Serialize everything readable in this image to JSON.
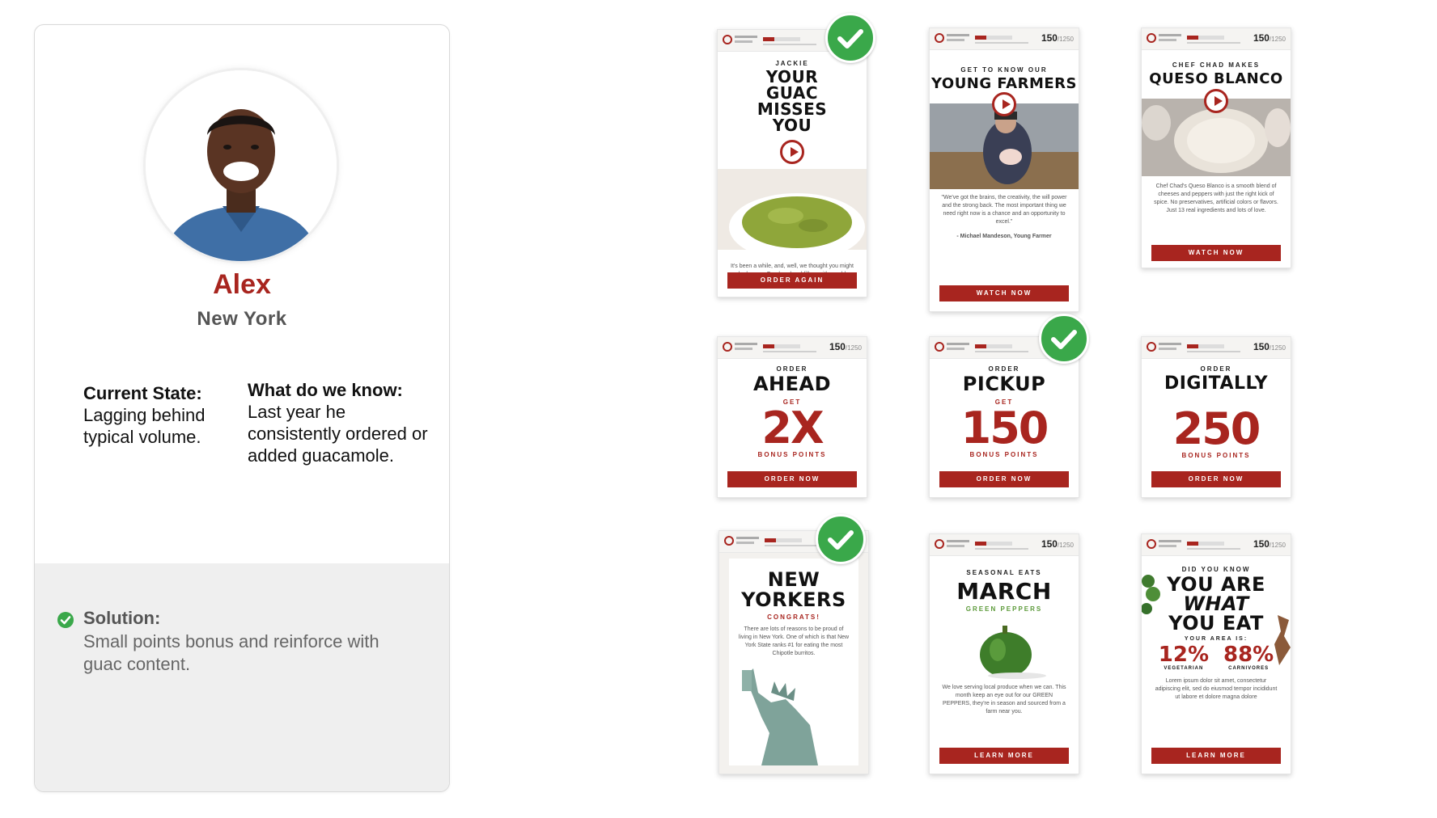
{
  "persona": {
    "name": "Alex",
    "city": "New York",
    "current_state_label": "Current State:",
    "current_state_text": "Lagging behind typical volume.",
    "know_label": "What do we know:",
    "know_text": "Last year he consistently ordered or added guacamole.",
    "solution_label": "Solution:",
    "solution_text": "Small points bonus and reinforce with guac content."
  },
  "tiles": {
    "guac": {
      "kicker": "JACKIE",
      "headline": "YOUR GUAC MISSES YOU",
      "body": "It's been a while, and, well, we thought you might be hungry. Go ahead and fill up with an old favorite.",
      "button": "ORDER AGAIN"
    },
    "farmers": {
      "points": "150",
      "points_total": "/1250",
      "kicker": "GET TO KNOW OUR",
      "headline": "YOUNG FARMERS",
      "body": "\"We've got the brains, the creativity, the will power and the strong back. The most important thing we need right now is a chance and an opportunity to excel.\"",
      "attribution": "- Michael Mandeson, Young Farmer",
      "button": "WATCH NOW"
    },
    "queso": {
      "points": "150",
      "points_total": "/1250",
      "kicker": "CHEF CHAD MAKES",
      "headline": "QUESO BLANCO",
      "body": "Chef Chad's Queso Blanco is a smooth blend of cheeses and peppers with just the right kick of spice. No preservatives, artificial colors or flavors. Just 13 real ingredients and lots of love.",
      "button": "WATCH NOW"
    },
    "ahead": {
      "points": "150",
      "points_total": "/1250",
      "kicker": "ORDER",
      "headline": "AHEAD",
      "get": "GET",
      "value": "2X",
      "sub": "BONUS POINTS",
      "button": "ORDER NOW"
    },
    "pickup": {
      "kicker": "ORDER",
      "headline": "PICKUP",
      "get": "GET",
      "value": "150",
      "sub": "BONUS POINTS",
      "button": "ORDER NOW"
    },
    "digitally": {
      "points": "150",
      "points_total": "/1250",
      "kicker": "ORDER",
      "headline": "DIGITALLY",
      "value": "250",
      "sub": "BONUS POINTS",
      "button": "ORDER NOW"
    },
    "newyorkers": {
      "headline": "NEW YORKERS",
      "sub": "CONGRATS!",
      "body": "There are lots of reasons to be proud of living in New York. One of which is that New York State ranks #1 for eating the most Chipotle burritos."
    },
    "march": {
      "points": "150",
      "points_total": "/1250",
      "kicker": "SEASONAL EATS",
      "headline": "MARCH",
      "sub": "GREEN PEPPERS",
      "body": "We love serving local produce when we can. This month keep an eye out for our GREEN PEPPERS, they're in season and sourced from a farm near you.",
      "button": "LEARN MORE"
    },
    "whatyoueat": {
      "points": "150",
      "points_total": "/1250",
      "kicker": "DID YOU KNOW",
      "headline1": "YOU ARE",
      "headline2": "WHAT",
      "headline3": "YOU EAT",
      "area": "YOUR AREA IS:",
      "stat1": "12%",
      "stat1_label": "VEGETARIAN",
      "stat2": "88%",
      "stat2_label": "CARNIVORES",
      "body": "Lorem ipsum dolor sit amet, consectetur adipiscing elit, sed do eiusmod tempor incididunt ut labore et dolore magna dolore",
      "button": "LEARN MORE"
    }
  },
  "colors": {
    "brand_red": "#a8251f",
    "check_green": "#3aa84a"
  },
  "icons": [
    "check-icon",
    "play-icon",
    "chipotle-logo-icon"
  ]
}
